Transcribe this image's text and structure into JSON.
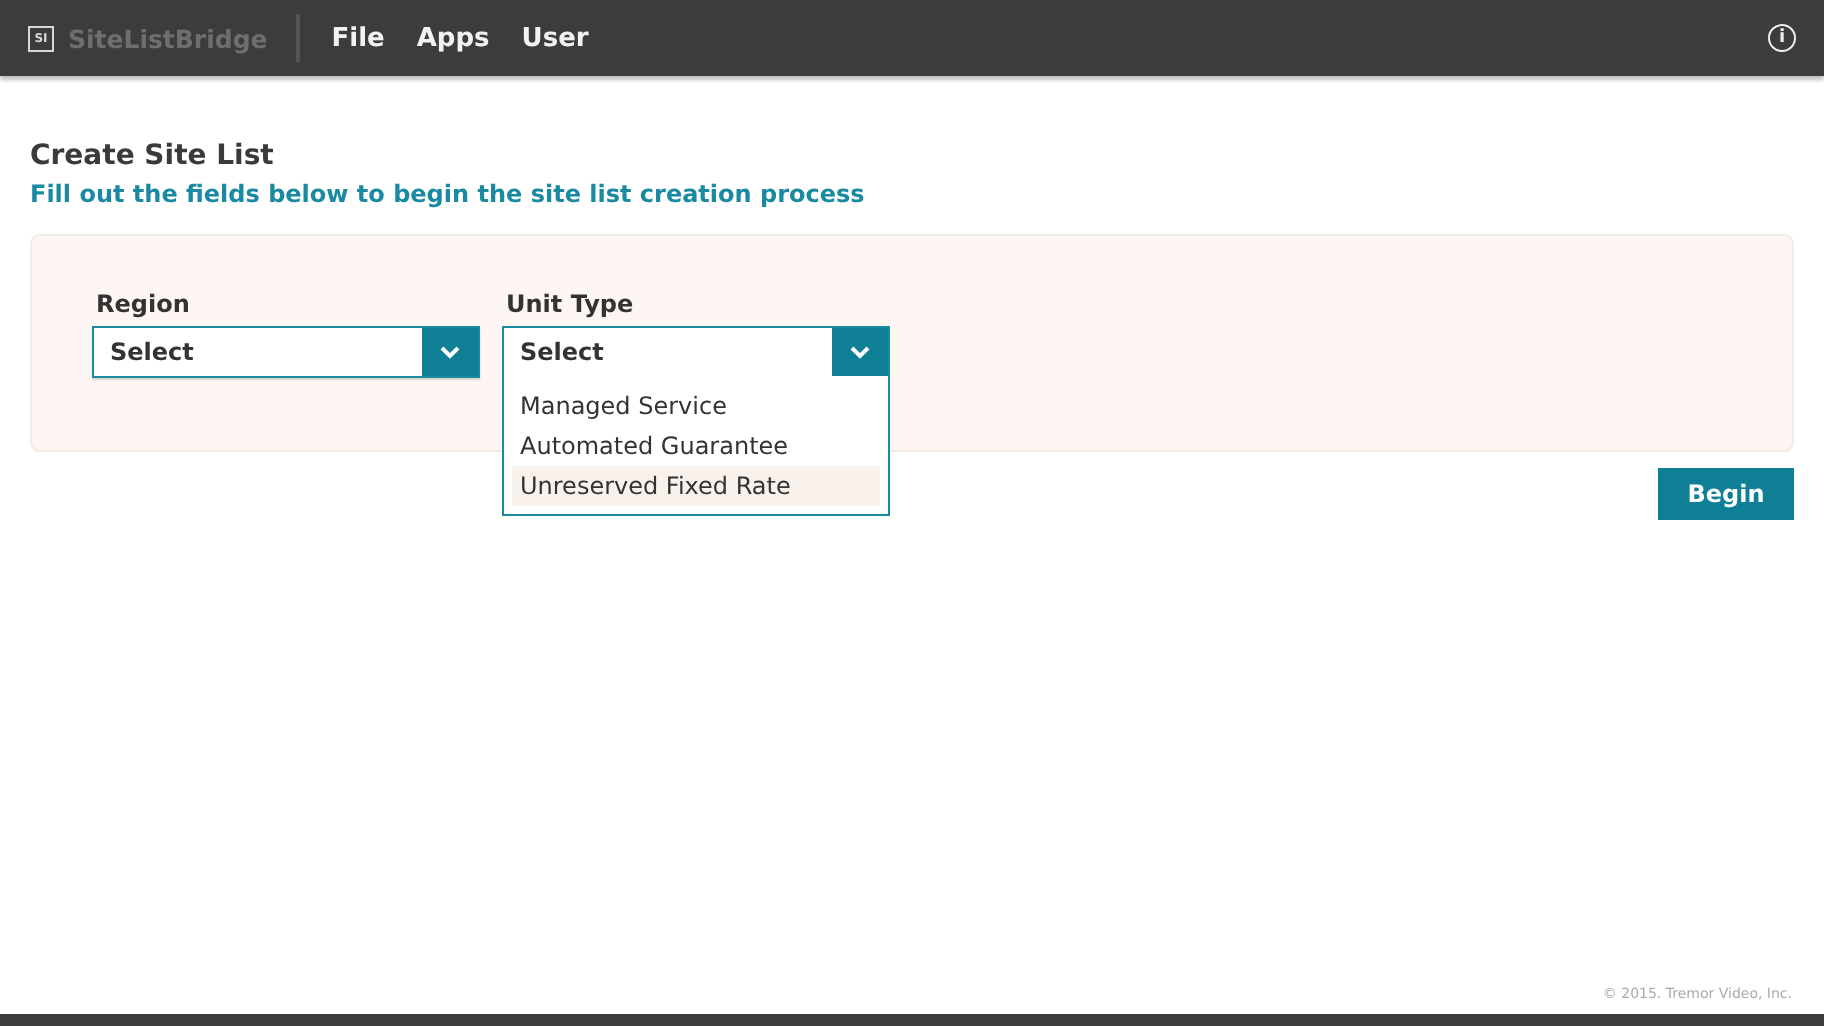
{
  "header": {
    "logo_mark": "SI",
    "app_name": "SiteListBridge",
    "menu": [
      {
        "label": "File"
      },
      {
        "label": "Apps"
      },
      {
        "label": "User"
      }
    ],
    "info_icon": "i"
  },
  "page": {
    "title": "Create Site List",
    "subtitle": "Fill out the fields below to begin the site list creation process"
  },
  "form": {
    "fields": [
      {
        "label": "Region",
        "value": "Select",
        "expanded": false
      },
      {
        "label": "Unit Type",
        "value": "Select",
        "expanded": true,
        "options": [
          {
            "label": "Managed Service",
            "selected": false
          },
          {
            "label": "Automated Guarantee",
            "selected": false
          },
          {
            "label": "Unreserved Fixed Rate",
            "selected": true
          }
        ]
      }
    ]
  },
  "begin_button": "Begin",
  "footer": {
    "copyright": "© 2015. Tremor Video, Inc."
  }
}
